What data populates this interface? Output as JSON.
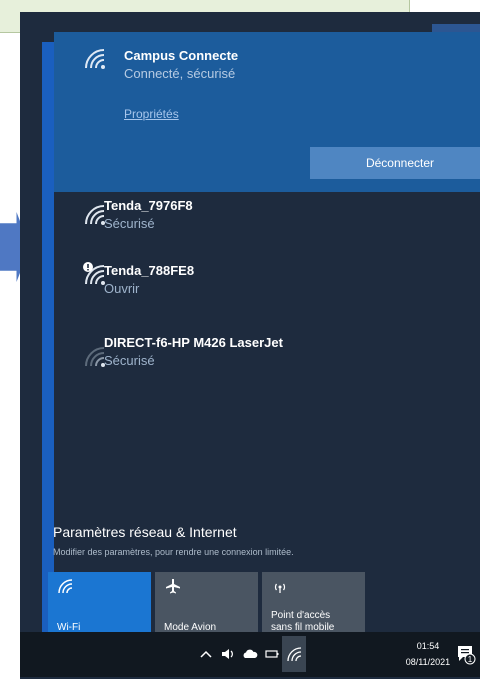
{
  "connected_network": {
    "name": "Campus Connecte",
    "status": "Connecté, sécurisé",
    "properties_link": "Propriétés",
    "disconnect_label": "Déconnecter"
  },
  "networks": [
    {
      "name": "Tenda_7976F8",
      "status": "Sécurisé",
      "icon": "wifi-icon"
    },
    {
      "name": "Tenda_788FE8",
      "status": "Ouvrir",
      "icon": "wifi-open-warning-icon"
    },
    {
      "name": "DIRECT-f6-HP M426 LaserJet",
      "status": "Sécurisé",
      "icon": "wifi-weak-icon"
    }
  ],
  "settings": {
    "title": "Paramètres réseau & Internet",
    "subtitle": "Modifier des paramètres, pour rendre une connexion limitée."
  },
  "quick_actions": [
    {
      "label": "Wi-Fi",
      "icon": "wifi-icon",
      "active": true
    },
    {
      "label": "Mode Avion",
      "icon": "airplane-icon",
      "active": false
    },
    {
      "label_line1": "Point d'accès",
      "label_line2": "sans fil mobile",
      "icon": "hotspot-icon",
      "active": false
    }
  ],
  "taskbar": {
    "time": "01:54",
    "date": "08/11/2021",
    "notification_count": "1"
  },
  "colors": {
    "flyout_bg": "#1e2b3e",
    "connected_bg": "#1c5c9c",
    "accent": "#1b76d2",
    "button": "#4f86c2"
  }
}
